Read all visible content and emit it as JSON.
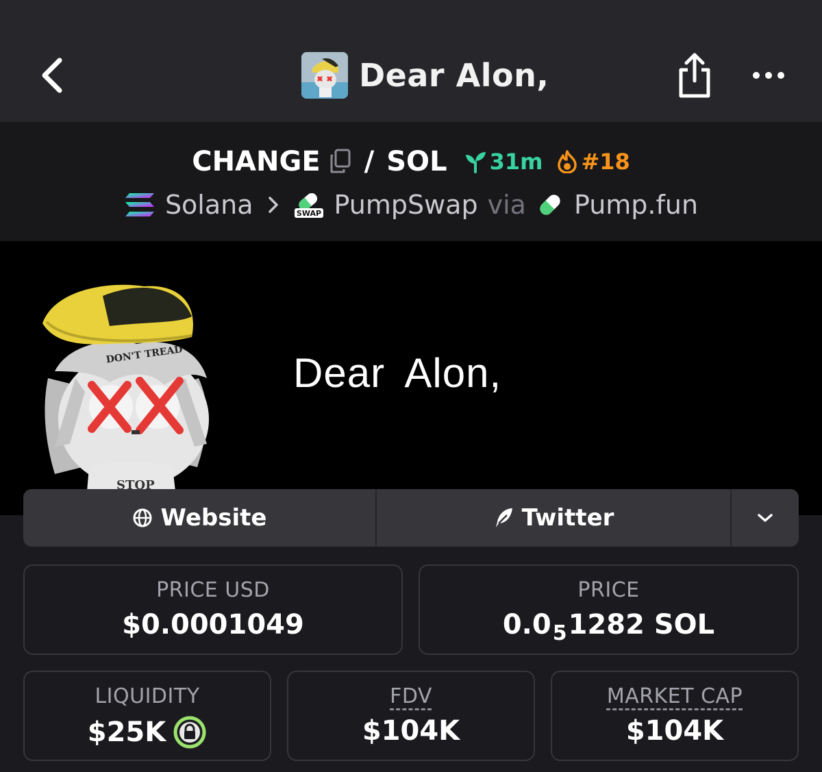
{
  "header": {
    "title": "Dear Alon,",
    "icons": {
      "back": "chevron-left-icon",
      "share": "share-icon",
      "more": "more-horizontal-icon"
    }
  },
  "pair": {
    "base": "CHANGE",
    "separator": "/",
    "quote": "SOL",
    "age": "31m",
    "rank": "#18",
    "colors": {
      "age": "#38d39f",
      "rank": "#f7931a"
    }
  },
  "route": {
    "chain": "Solana",
    "dex": "PumpSwap",
    "via": "via",
    "launchpad": "Pump.fun",
    "dex_badge": "SWAP"
  },
  "banner": {
    "text": "Dear  Alon,",
    "hat_text": "DON'T TREAD",
    "shirt_text": "STOP"
  },
  "links": {
    "website": "Website",
    "twitter": "Twitter"
  },
  "stats": {
    "price_usd": {
      "label": "PRICE USD",
      "value": "$0.0001049"
    },
    "price": {
      "label": "PRICE",
      "prefix": "0.0",
      "zeros": "5",
      "suffix": "1282 SOL"
    },
    "liquidity": {
      "label": "LIQUIDITY",
      "value": "$25K"
    },
    "fdv": {
      "label": "FDV",
      "value": "$104K"
    },
    "market_cap": {
      "label": "MARKET CAP",
      "value": "$104K"
    }
  }
}
